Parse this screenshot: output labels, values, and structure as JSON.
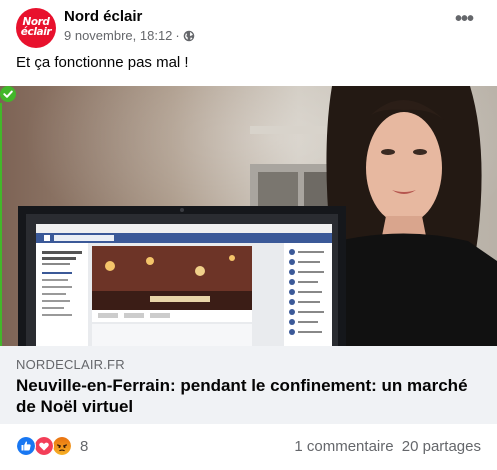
{
  "post": {
    "page_name": "Nord éclair",
    "avatar_logo_line1": "Nord",
    "avatar_logo_line2": "éclair",
    "date": "9 novembre, 18:12",
    "separator": "·",
    "privacy_icon": "globe-icon",
    "more_label": "•••",
    "text": "Et ça fonctionne pas mal !"
  },
  "media": {
    "description_icon": "verified-check-icon"
  },
  "link_preview": {
    "domain": "NORDECLAIR.FR",
    "title": "Neuville-en-Ferrain: pendant le confinement: un marché de Noël virtuel"
  },
  "footer": {
    "reaction_icons": [
      "like-icon",
      "love-icon",
      "angry-icon"
    ],
    "reaction_count": "8",
    "comments": "1 commentaire",
    "shares": "20 partages"
  },
  "colors": {
    "brand_red": "#e8112d",
    "like_blue": "#1877f2",
    "love_red": "#f33e58",
    "angry_orange": "#e9710f",
    "verified_green": "#42b72a"
  }
}
